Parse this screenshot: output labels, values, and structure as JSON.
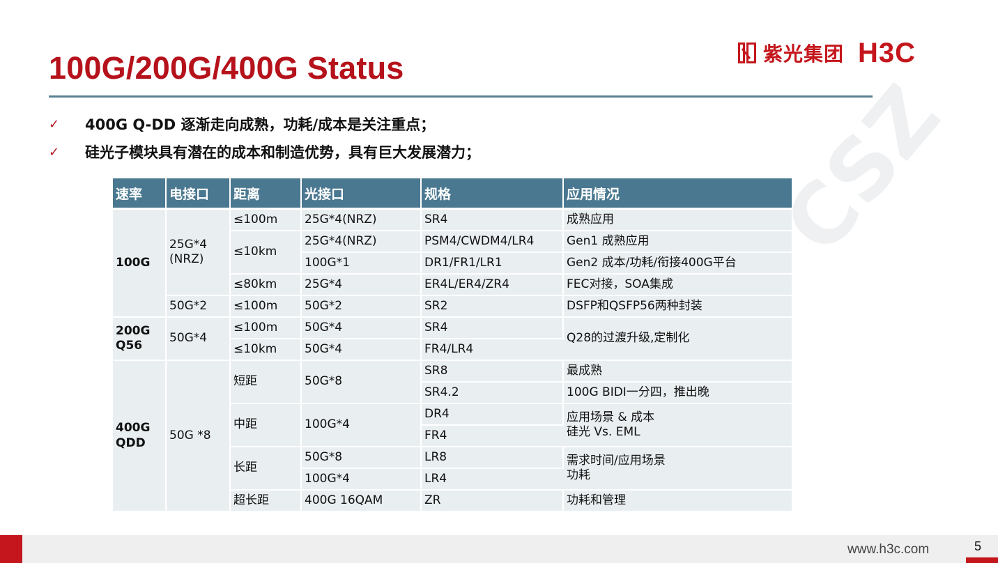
{
  "slide": {
    "title": "100G/200G/400G  Status",
    "logo": {
      "cn": "紫光集团",
      "en": "H3C"
    },
    "watermark": "CSZ",
    "bullets": [
      {
        "check": "✓",
        "text": "400G Q-DD 逐渐走向成熟，功耗/成本是关注重点；"
      },
      {
        "check": "✓",
        "text": "硅光子模块具有潜在的成本和制造优势，具有巨大发展潜力；"
      }
    ]
  },
  "table": {
    "headers": [
      "速率",
      "电接口",
      "距离",
      "光接口",
      "规格",
      "应用情况"
    ],
    "cells": {
      "r100g": "100G",
      "e_25g4": "25G*4",
      "e_25g4_nrz": "(NRZ)",
      "d_100m_a": "≤100m",
      "o_25g4nrz_a": "25G*4(NRZ)",
      "s_sr4_a": "SR4",
      "a_mature": "成熟应用",
      "d_10km_a": "≤10km",
      "o_25g4nrz_b": "25G*4(NRZ)",
      "s_psm4": "PSM4/CWDM4/LR4",
      "a_gen1": "Gen1 成熟应用",
      "o_100g1": "100G*1",
      "s_dr1": "DR1/FR1/LR1",
      "a_gen2": "Gen2 成本/功耗/衔接400G平台",
      "d_80km": "≤80km",
      "o_25g4": "25G*4",
      "s_er4l": "ER4L/ER4/ZR4",
      "a_fec": "FEC对接，SOA集成",
      "e_50g2": "50G*2",
      "d_100m_b": "≤100m",
      "o_50g2": "50G*2",
      "s_sr2": "SR2",
      "a_dsfp": "DSFP和QSFP56两种封装",
      "r200g_1": "200G",
      "r200g_2": "Q56",
      "e_50g4": "50G*4",
      "d_100m_c": "≤100m",
      "o_50g4_a": "50G*4",
      "s_sr4_b": "SR4",
      "a_q28": "Q28的过渡升级,定制化",
      "d_10km_b": "≤10km",
      "o_50g4_b": "50G*4",
      "s_fr4lr4": "FR4/LR4",
      "r400g_1": "400G",
      "r400g_2": "QDD",
      "e_50g8": "50G *8",
      "d_short": "短距",
      "o_50g8_a": "50G*8",
      "s_sr8": "SR8",
      "a_most": "最成熟",
      "s_sr42": "SR4.2",
      "a_bidi": "100G BIDI一分四，推出晚",
      "d_mid": "中距",
      "o_100g4_a": "100G*4",
      "s_dr4": "DR4",
      "a_scene_1": "应用场景 & 成本",
      "a_scene_2": "硅光  Vs. EML",
      "s_fr4": "FR4",
      "d_long": "长距",
      "o_50g8_b": "50G*8",
      "s_lr8": "LR8",
      "a_req_1": "需求时间/应用场景",
      "a_req_2": "功耗",
      "o_100g4_b": "100G*4",
      "s_lr4": "LR4",
      "d_ultra": "超长距",
      "o_400g16": "400G 16QAM",
      "s_zr": "ZR",
      "a_power": "功耗和管理"
    }
  },
  "footer": {
    "url": "www.h3c.com",
    "page": "5"
  },
  "colors": {
    "brand_red": "#c4161c",
    "title_red": "#b5121b",
    "header_blue": "#4a7890",
    "cell_bg": "#e9eef1"
  }
}
